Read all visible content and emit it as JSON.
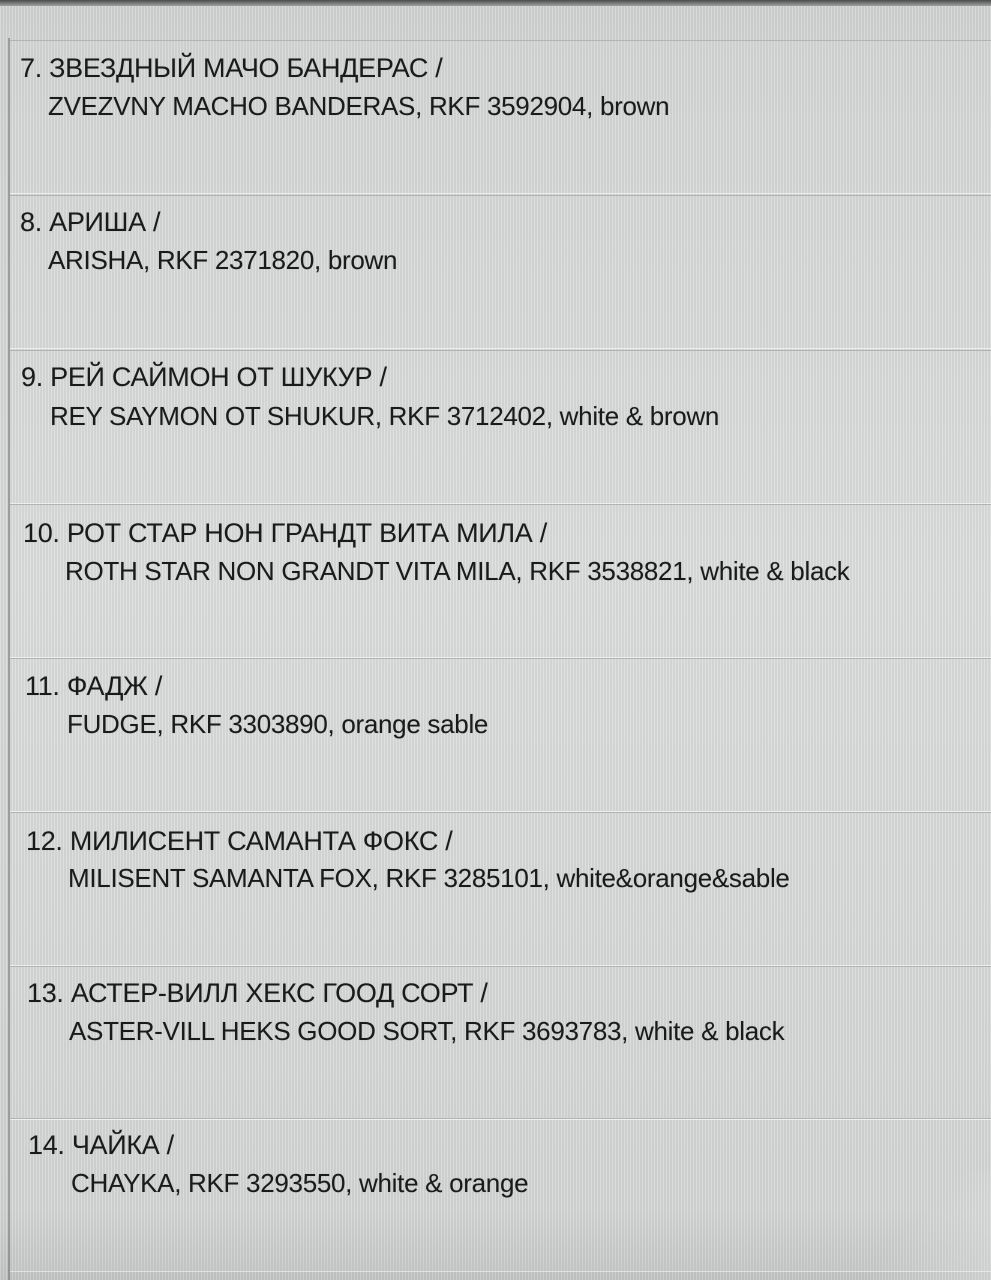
{
  "entries": [
    {
      "line1": "7. ЗВЕЗДНЫЙ МАЧО БАНДЕРАС /",
      "line2": "ZVEZVNY MACHO BANDERAS, RKF 3592904, brown"
    },
    {
      "line1": "8. АРИША /",
      "line2": "ARISHA, RKF 2371820, brown"
    },
    {
      "line1": "9. РЕЙ САЙМОН ОТ ШУКУР /",
      "line2": "REY SAYMON OT SHUKUR, RKF 3712402, white & brown"
    },
    {
      "line1": "10. РОТ СТАР НОН ГРАНДТ ВИТА МИЛА /",
      "line2": "ROTH STAR NON GRANDT VITA MILA, RKF 3538821, white & black"
    },
    {
      "line1": "11. ФАДЖ /",
      "line2": "FUDGE, RKF 3303890, orange sable"
    },
    {
      "line1": "12. МИЛИСЕНТ САМАНТА ФОКС /",
      "line2": "MILISENT SAMANTA FOX, RKF 3285101, white&orange&sable"
    },
    {
      "line1": "13. АСТЕР-ВИЛЛ ХЕКС ГООД СОРТ /",
      "line2": "ASTER-VILL HEKS GOOD SORT, RKF 3693783, white & black"
    },
    {
      "line1": "14. ЧАЙКА /",
      "line2": "CHAYKA, RKF 3293550, white & orange"
    }
  ]
}
